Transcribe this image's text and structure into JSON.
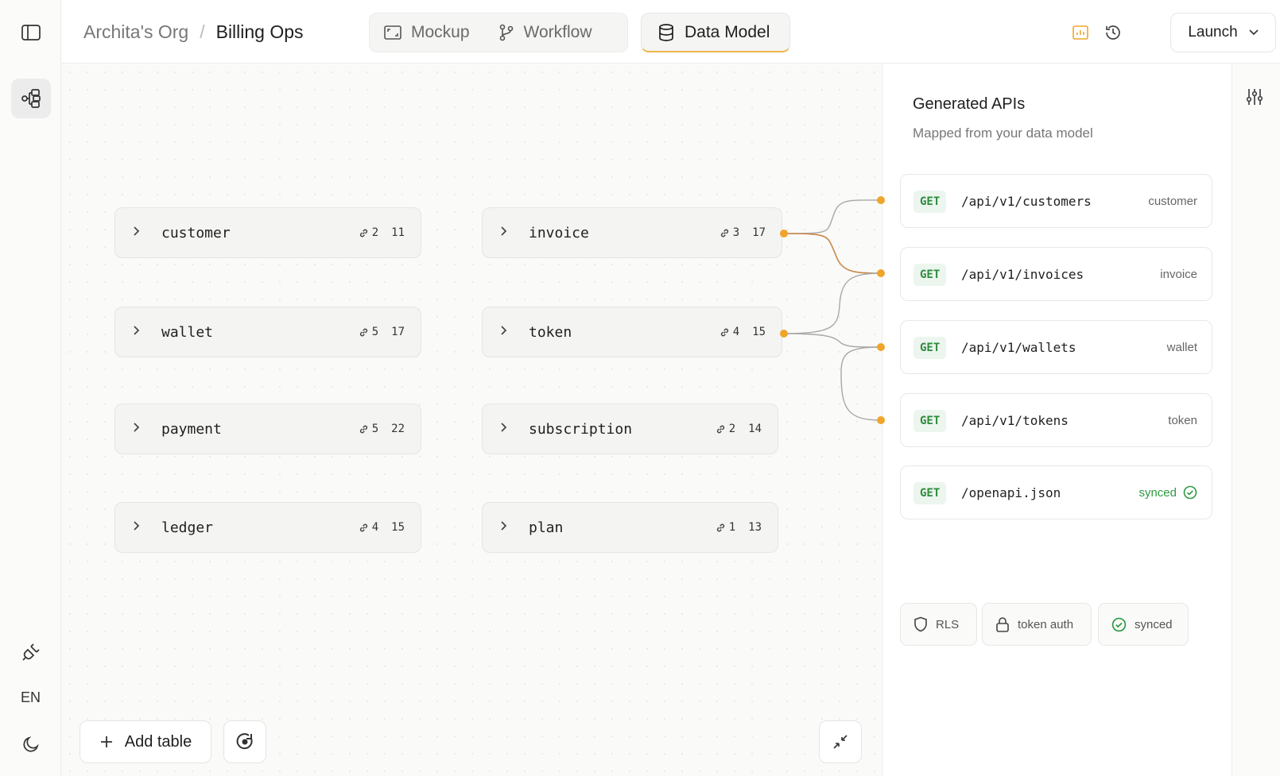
{
  "breadcrumb": {
    "org": "Archita's Org",
    "sep": "/",
    "project": "Billing Ops"
  },
  "modes": {
    "mockup": "Mockup",
    "workflow": "Workflow",
    "data_model": "Data Model",
    "active": "Data Model"
  },
  "launch": {
    "label": "Launch"
  },
  "rail": {
    "lang": "EN"
  },
  "tables": [
    {
      "name": "customer",
      "links": "2",
      "columns": "11"
    },
    {
      "name": "invoice",
      "links": "3",
      "columns": "17"
    },
    {
      "name": "wallet",
      "links": "5",
      "columns": "17"
    },
    {
      "name": "token",
      "links": "4",
      "columns": "15"
    },
    {
      "name": "payment",
      "links": "5",
      "columns": "22"
    },
    {
      "name": "subscription",
      "links": "2",
      "columns": "14"
    },
    {
      "name": "ledger",
      "links": "4",
      "columns": "15"
    },
    {
      "name": "plan",
      "links": "1",
      "columns": "13"
    }
  ],
  "canvas": {
    "add_table": "Add table"
  },
  "panel": {
    "title": "Generated APIs",
    "subtitle": "Mapped from your data model",
    "apis": [
      {
        "verb": "GET",
        "path": "/api/v1/customers",
        "entity": "customer"
      },
      {
        "verb": "GET",
        "path": "/api/v1/invoices",
        "entity": "invoice"
      },
      {
        "verb": "GET",
        "path": "/api/v1/wallets",
        "entity": "wallet"
      },
      {
        "verb": "GET",
        "path": "/api/v1/tokens",
        "entity": "token"
      },
      {
        "verb": "GET",
        "path": "/openapi.json",
        "entity": "synced"
      }
    ],
    "chips": {
      "rls": "RLS",
      "auth": "token auth",
      "synced": "synced"
    }
  },
  "colors": {
    "accent": "#f0a52a",
    "ok": "#2e9a42"
  }
}
